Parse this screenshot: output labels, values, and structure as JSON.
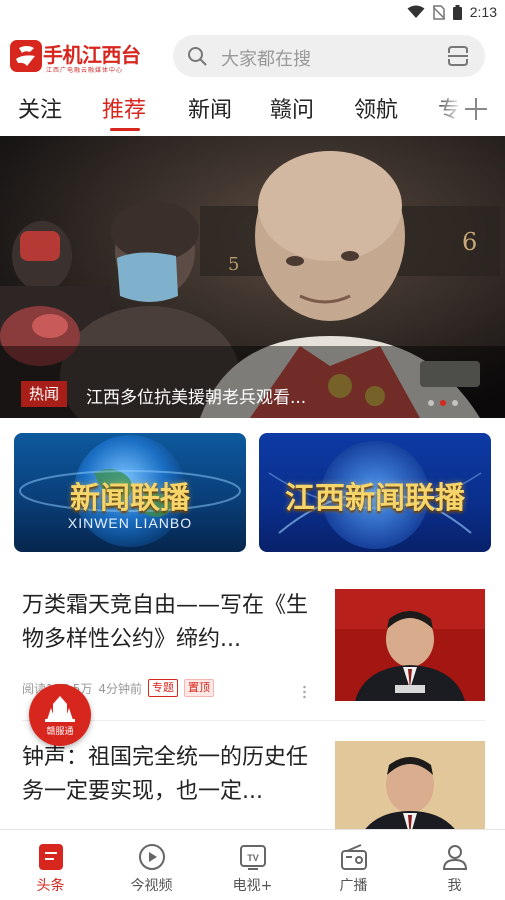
{
  "status_bar": {
    "time": "2:13",
    "icons": [
      "wifi-icon",
      "no-sim-icon",
      "battery-icon"
    ]
  },
  "header": {
    "logo_text": "手机江西台",
    "logo_subtext": "江西广电融云融媒体中心",
    "search_placeholder": "大家都在搜"
  },
  "tabs": {
    "items": [
      "关注",
      "推荐",
      "新闻",
      "赣问",
      "领航",
      "专"
    ],
    "active_index": 1
  },
  "hero": {
    "badge": "热闻",
    "title": "江西多位抗美援朝老兵观看...",
    "dot_count": 3,
    "active_dot": 1
  },
  "programs": [
    {
      "title": "新闻联播",
      "subtitle": "XINWEN LIANBO"
    },
    {
      "title": "江西新闻联播",
      "subtitle": ""
    }
  ],
  "news": [
    {
      "title": "万类霜天竞自由——写在《生物多样性公约》缔约...",
      "reads": "阅读157.5万",
      "time": "4分钟前",
      "tags": [
        "专题",
        "置顶"
      ]
    },
    {
      "title": "钟声：祖国完全统一的历史任务一定要实现，也一定...",
      "reads": "",
      "time": "",
      "tags": []
    }
  ],
  "float_button": {
    "label": "赣服通"
  },
  "bottom_nav": {
    "items": [
      {
        "label": "头条",
        "icon": "headline-icon"
      },
      {
        "label": "今视频",
        "icon": "play-icon"
      },
      {
        "label": "电视+",
        "icon": "tv-icon"
      },
      {
        "label": "广播",
        "icon": "radio-icon"
      },
      {
        "label": "我",
        "icon": "user-icon"
      }
    ],
    "active_index": 0
  },
  "colors": {
    "accent": "#d7261e",
    "text": "#222222",
    "muted": "#999999"
  }
}
